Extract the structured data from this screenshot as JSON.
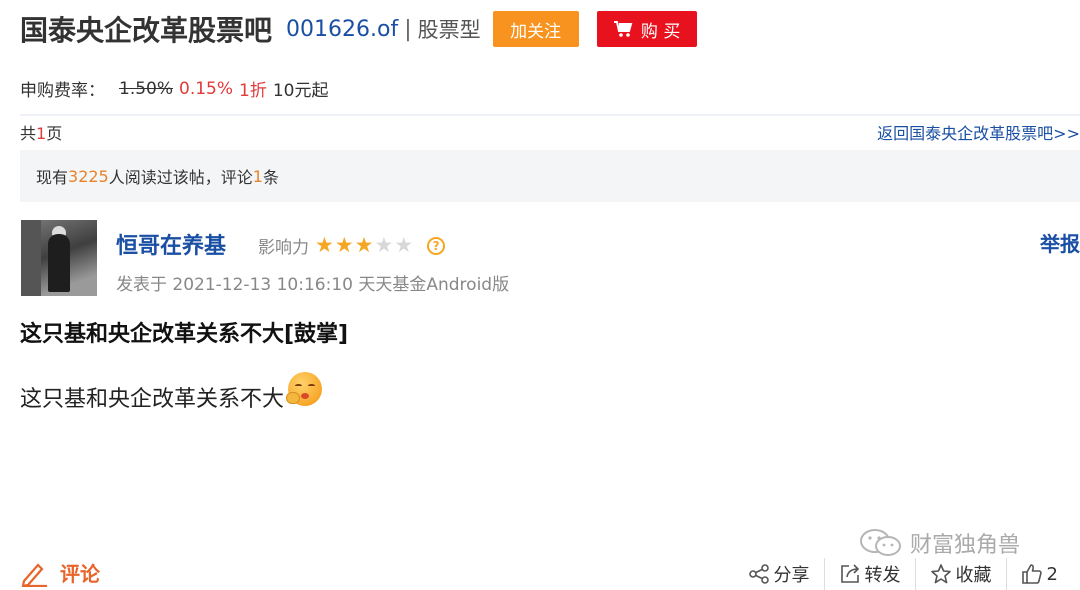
{
  "header": {
    "bar_title": "国泰央企改革股票吧",
    "fund_code": "001626.of",
    "separator": "|",
    "fund_type": "股票型",
    "follow_label": "加关注",
    "buy_label": "购 买"
  },
  "fee": {
    "label": "申购费率：",
    "old_rate": "1.50%",
    "new_rate": "0.15%",
    "discount": "1折",
    "min": "10元起"
  },
  "pagination": {
    "prefix": "共",
    "count": "1",
    "suffix": "页",
    "back_link": "返回国泰央企改革股票吧>>"
  },
  "stats": {
    "prefix": "现有",
    "readers": "3225",
    "mid": "人阅读过该帖，评论",
    "comments": "1",
    "suffix": "条"
  },
  "post": {
    "username": "恒哥在养基",
    "influence_label": "影响力",
    "stars_on": 3,
    "stars_total": 5,
    "report_label": "举报",
    "meta": "发表于 2021-12-13 10:16:10 天天基金Android版",
    "title": "这只基和央企改革关系不大[鼓掌]",
    "body": "这只基和央企改革关系不大"
  },
  "watermark": "财富独角兽",
  "footer": {
    "comment_label": "评论",
    "share_label": "分享",
    "repost_label": "转发",
    "favorite_label": "收藏",
    "like_count": "2"
  },
  "colors": {
    "link_blue": "#1a4fa3",
    "follow_orange": "#f7931e",
    "buy_red": "#e8121f",
    "accent_red": "#e03a3a",
    "stat_orange": "#e8832a",
    "star": "#f5a623"
  }
}
